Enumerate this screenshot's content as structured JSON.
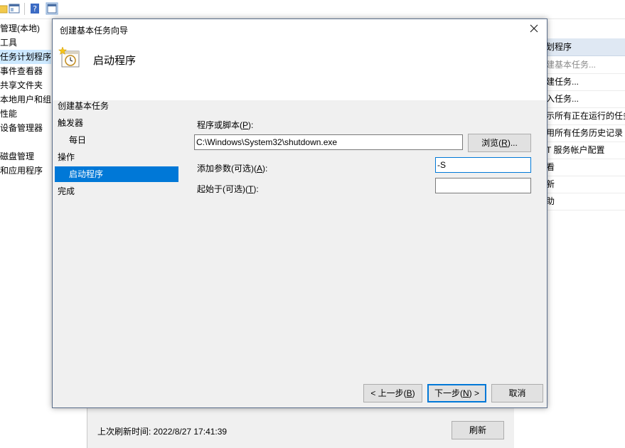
{
  "background": {
    "tree_items": [
      {
        "label": "管理(本地)",
        "selected": false
      },
      {
        "label": "工具",
        "selected": false
      },
      {
        "label": "任务计划程序",
        "selected": true
      },
      {
        "label": "事件查看器",
        "selected": false
      },
      {
        "label": "共享文件夹",
        "selected": false
      },
      {
        "label": "本地用户和组",
        "selected": false
      },
      {
        "label": "性能",
        "selected": false
      },
      {
        "label": "设备管理器",
        "selected": false
      },
      {
        "label": "",
        "selected": false
      },
      {
        "label": "磁盘管理",
        "selected": false
      },
      {
        "label": "和应用程序",
        "selected": false
      }
    ],
    "actions_header": "划程序",
    "actions": [
      {
        "label": "建基本任务...",
        "disabled": true
      },
      {
        "label": "建任务...",
        "disabled": false
      },
      {
        "label": "入任务...",
        "disabled": false
      },
      {
        "label": "示所有正在运行的任务",
        "disabled": false
      },
      {
        "label": "用所有任务历史记录",
        "disabled": false
      },
      {
        "label": "T 服务帐户配置",
        "disabled": false
      },
      {
        "label": "看",
        "disabled": false
      },
      {
        "label": "新",
        "disabled": false
      },
      {
        "label": "助",
        "disabled": false
      }
    ],
    "last_refresh": "上次刷新时间: 2022/8/27 17:41:39",
    "refresh_button": "刷新"
  },
  "dialog": {
    "title": "创建基本任务向导",
    "header_title": "启动程序",
    "steps": [
      {
        "label": "创建基本任务",
        "indent": false,
        "selected": false
      },
      {
        "label": "触发器",
        "indent": false,
        "selected": false
      },
      {
        "label": "每日",
        "indent": true,
        "selected": false
      },
      {
        "label": "操作",
        "indent": false,
        "selected": false
      },
      {
        "label": "启动程序",
        "indent": true,
        "selected": true
      },
      {
        "label": "完成",
        "indent": false,
        "selected": false
      }
    ],
    "program_label": "程序或脚本",
    "program_label_key": "P",
    "program_value": "C:\\Windows\\System32\\shutdown.exe",
    "browse_button": "浏览",
    "browse_key": "R",
    "args_label": "添加参数(可选)",
    "args_key": "A",
    "args_value": "-S",
    "start_in_label": "起始于(可选)",
    "start_in_key": "T",
    "start_in_value": "",
    "back_button": "< 上一步",
    "back_key": "B",
    "next_button": "下一步",
    "next_key": "N",
    "cancel_button": "取消"
  }
}
